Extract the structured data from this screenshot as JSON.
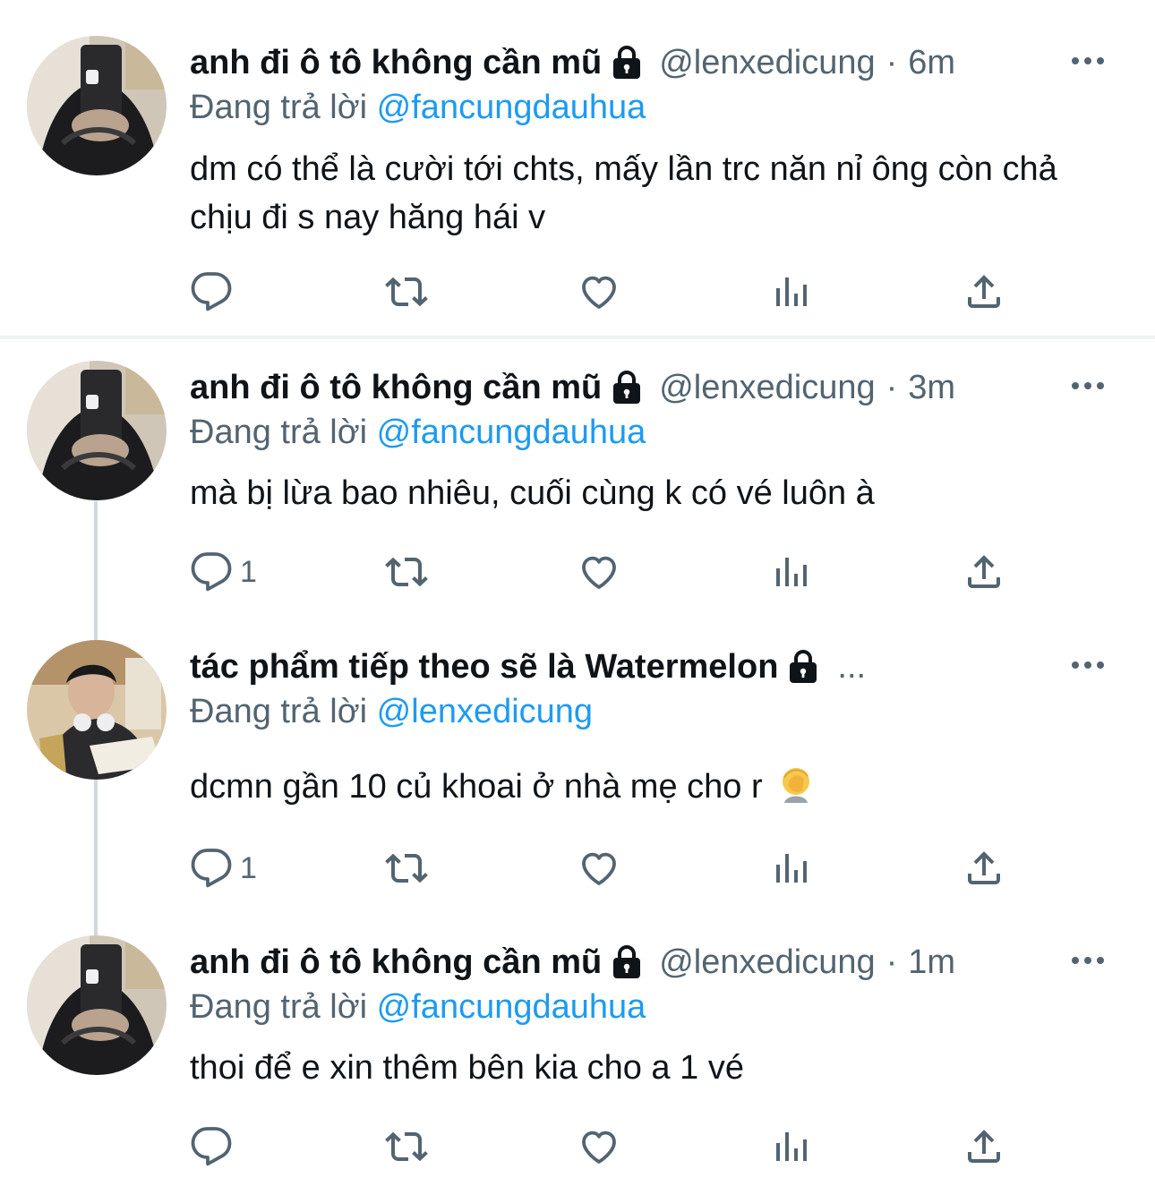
{
  "tweets": [
    {
      "name": "anh đi ô tô không cần mũ",
      "handle": "@lenxedicung",
      "separator": "·",
      "time": "6m",
      "reply_prefix": "Đang trả lời",
      "reply_to": "@fancungdauhua",
      "text": "dm có thể là cười tới chts, mấy lần trc năn nỉ ông còn chả chịu đi s nay hăng hái v",
      "reply_count": ""
    },
    {
      "name": "anh đi ô tô không cần mũ",
      "handle": "@lenxedicung",
      "separator": "·",
      "time": "3m",
      "reply_prefix": "Đang trả lời",
      "reply_to": "@fancungdauhua",
      "text": "mà bị lừa bao nhiêu, cuối cùng k có vé luôn à",
      "reply_count": "1"
    },
    {
      "name": "tác phẩm tiếp theo sẽ là Watermelon",
      "truncation": "...",
      "reply_prefix": "Đang trả lời",
      "reply_to": "@lenxedicung",
      "text": "dcmn gần 10 củ khoai ở nhà mẹ cho r",
      "emoji": "face-palm",
      "reply_count": "1"
    },
    {
      "name": "anh đi ô tô không cần mũ",
      "handle": "@lenxedicung",
      "separator": "·",
      "time": "1m",
      "reply_prefix": "Đang trả lời",
      "reply_to": "@fancungdauhua",
      "text": "thoi để e xin thêm bên kia cho a 1 vé",
      "reply_count": ""
    }
  ],
  "icons": {
    "reply": "comment-bubble-icon",
    "retweet": "retweet-icon",
    "like": "heart-icon",
    "analytics": "bar-chart-icon",
    "share": "share-upload-icon",
    "more": "more-dots-icon",
    "protected": "lock-icon"
  },
  "colors": {
    "name": "#0f1419",
    "secondary": "#536471",
    "link": "#1d9bf0",
    "divider": "#eff3f4",
    "thread_line": "#cfd9de"
  }
}
